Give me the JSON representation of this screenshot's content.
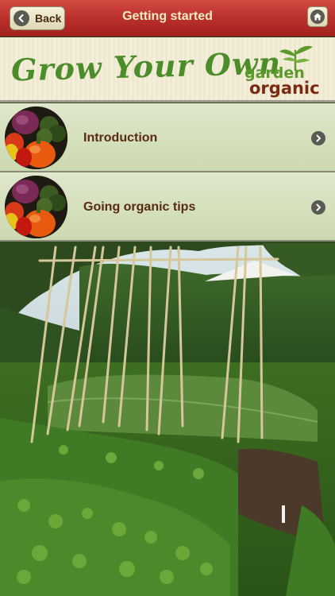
{
  "header": {
    "back_label": "Back",
    "title": "Getting started"
  },
  "banner": {
    "title": "Grow Your Own",
    "logo_line1": "garden",
    "logo_line2": "organic"
  },
  "menu": {
    "items": [
      {
        "label": "Introduction",
        "icon": "vegetables-thumbnail"
      },
      {
        "label": "Going organic tips",
        "icon": "vegetables-thumbnail"
      }
    ]
  },
  "colors": {
    "header_red": "#b82f2a",
    "header_title": "#f8ecc0",
    "menu_bg": "#d6e0bf",
    "menu_text": "#5a2a10",
    "banner_green": "#4b8d2a"
  }
}
